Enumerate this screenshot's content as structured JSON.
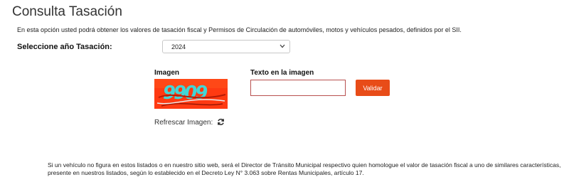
{
  "page": {
    "title": "Consulta Tasación",
    "intro": "En esta opción usted podrá obtener los valores de tasación fiscal y Permisos de Circulación de automóviles, motos y vehículos pesados, definidos por el SII."
  },
  "form": {
    "year_label": "Seleccione año Tasación:",
    "year_value": "2024",
    "image_label": "Imagen",
    "captcha_text": "9909",
    "refresh_label": "Refrescar Imagen:",
    "text_label": "Texto en la imagen",
    "text_value": "",
    "validate_label": "Validar"
  },
  "footnote": "Si un vehículo no figura en estos listados o en nuestro sitio web, será el Director de Tránsito Municipal respectivo quien homologue el valor de tasación fiscal a uno de similares características, presente en nuestros listados, según lo establecido en el Decreto Ley N° 3.063 sobre Rentas Municipales, artículo 17.",
  "colors": {
    "accent": "#e84c18",
    "captcha_bg": "#ff3a12",
    "captcha_glyph": "#41d6d6",
    "input_border": "#b8504f"
  },
  "icons": {
    "refresh": "refresh-icon",
    "dropdown": "chevron-down-icon"
  }
}
